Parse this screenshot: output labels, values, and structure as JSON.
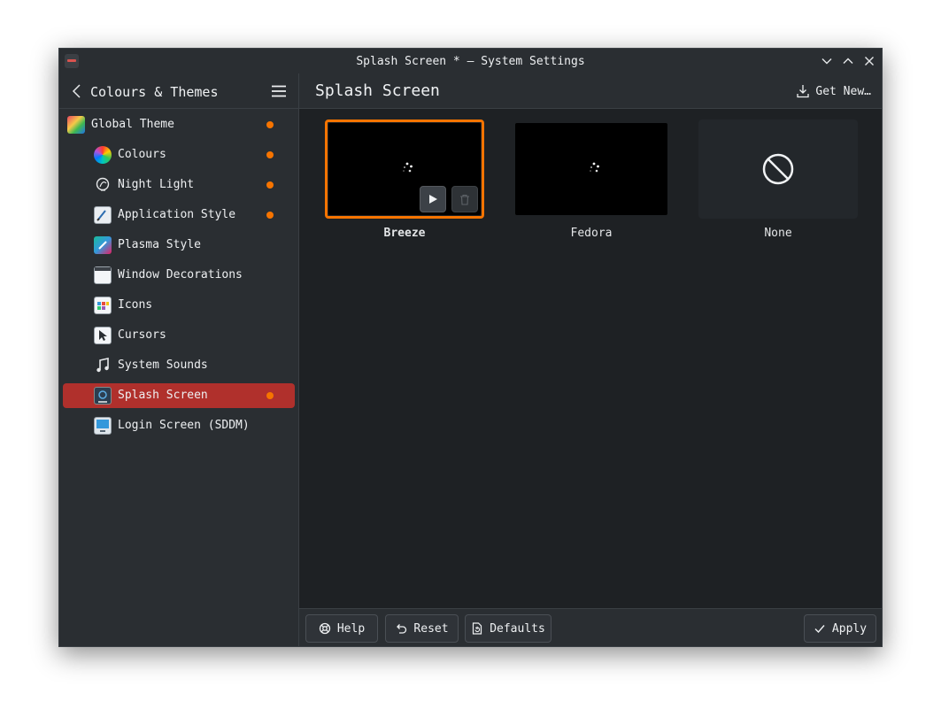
{
  "window": {
    "title": "Splash Screen * — System Settings"
  },
  "sidebar": {
    "title": "Colours & Themes",
    "items": [
      {
        "label": "Global Theme",
        "icon": "global-theme-icon",
        "modified": true
      },
      {
        "label": "Colours",
        "icon": "colours-icon",
        "modified": true
      },
      {
        "label": "Night Light",
        "icon": "night-light-icon",
        "modified": true
      },
      {
        "label": "Application Style",
        "icon": "application-style-icon",
        "modified": true
      },
      {
        "label": "Plasma Style",
        "icon": "plasma-style-icon",
        "modified": false
      },
      {
        "label": "Window Decorations",
        "icon": "window-decorations-icon",
        "modified": false
      },
      {
        "label": "Icons",
        "icon": "icons-icon",
        "modified": false
      },
      {
        "label": "Cursors",
        "icon": "cursors-icon",
        "modified": false
      },
      {
        "label": "System Sounds",
        "icon": "system-sounds-icon",
        "modified": false
      },
      {
        "label": "Splash Screen",
        "icon": "splash-screen-icon",
        "modified": true,
        "active": true
      },
      {
        "label": "Login Screen (SDDM)",
        "icon": "login-screen-icon",
        "modified": false
      }
    ]
  },
  "main": {
    "title": "Splash Screen",
    "get_new_label": "Get New…",
    "themes": [
      {
        "label": "Breeze",
        "selected": true
      },
      {
        "label": "Fedora",
        "selected": false
      },
      {
        "label": "None",
        "selected": false
      }
    ]
  },
  "footer": {
    "help_label": "Help",
    "reset_label": "Reset",
    "defaults_label": "Defaults",
    "apply_label": "Apply"
  },
  "colors": {
    "accent": "#f67400",
    "active_item": "#b0302c",
    "window_bg": "#1e2124",
    "panel_bg": "#2a2e32"
  }
}
